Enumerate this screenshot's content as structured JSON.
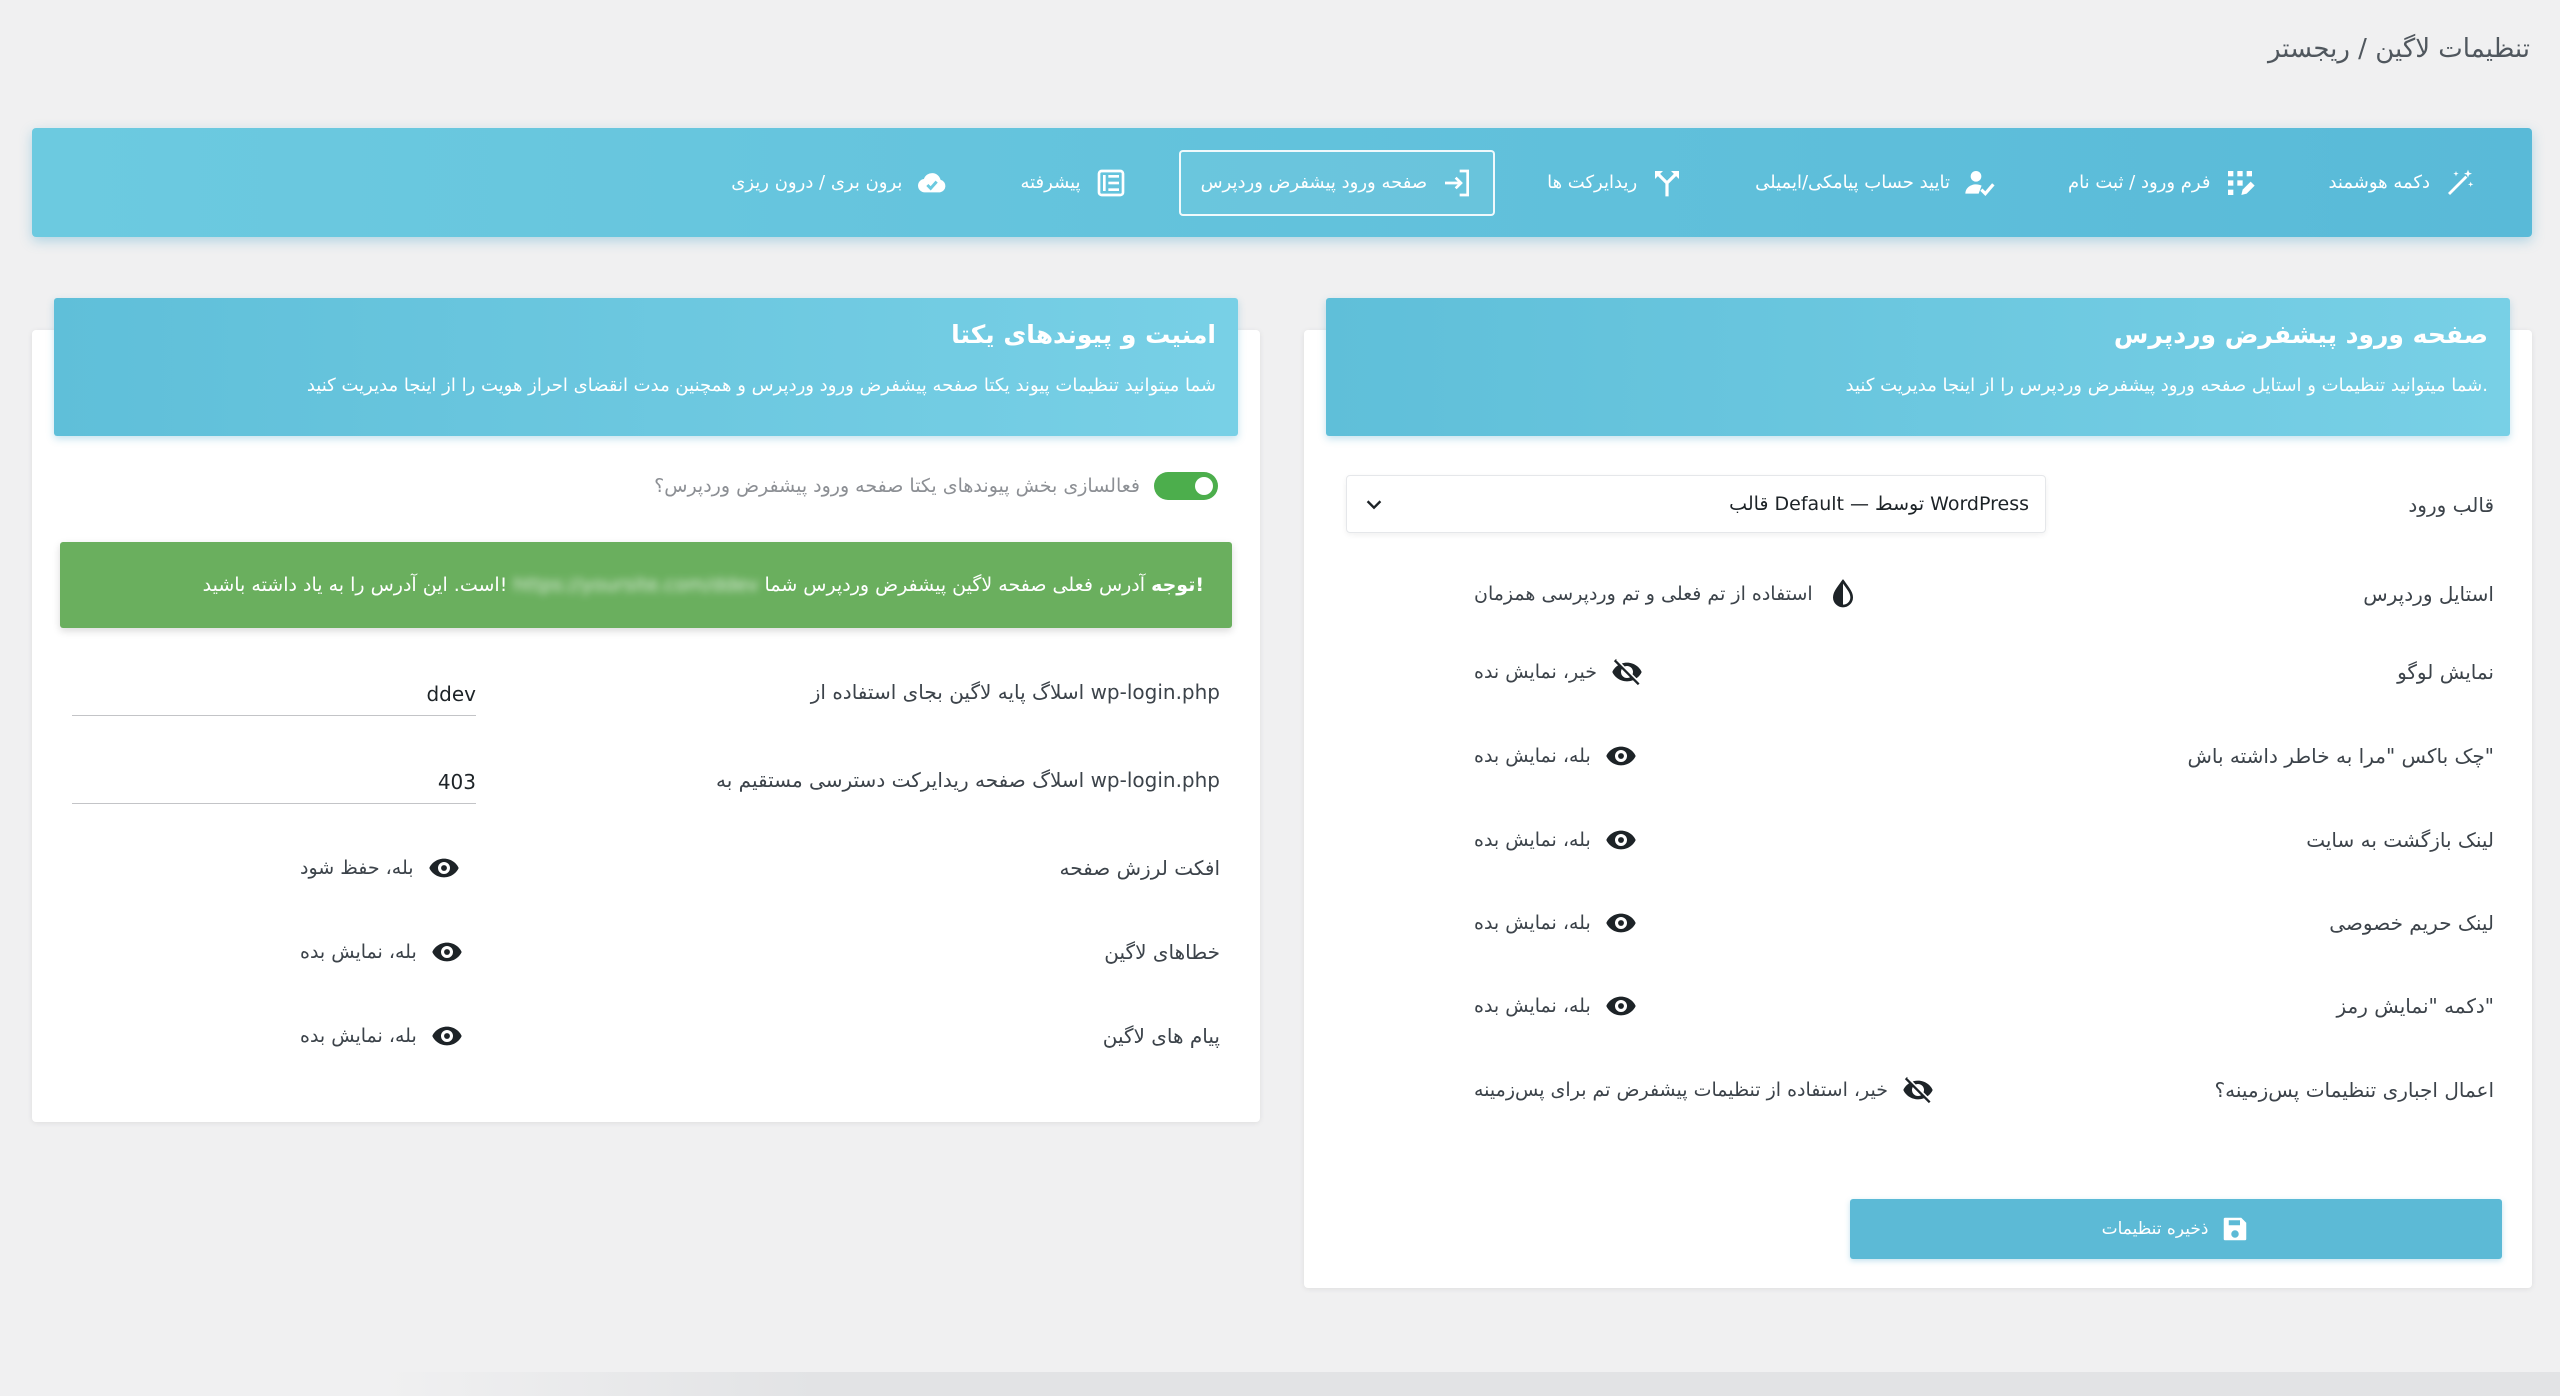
{
  "page": {
    "title": "تنظیمات لاگین / ریجستر"
  },
  "tabs": [
    {
      "label": "دکمه هوشمند",
      "icon": "magic-wand-icon"
    },
    {
      "label": "فرم ورود / ثبت نام",
      "icon": "grid-pencil-icon"
    },
    {
      "label": "تایید حساب پیامکی/ایمیلی",
      "icon": "user-check-icon"
    },
    {
      "label": "ریدایرکت ها",
      "icon": "split-arrows-icon"
    },
    {
      "label": "صفحه ورود پیشفرض وردپرس",
      "icon": "sign-in-icon",
      "active": true
    },
    {
      "label": "پیشرفته",
      "icon": "advanced-panel-icon"
    },
    {
      "label": "برون بری / درون ریزی",
      "icon": "cloud-check-icon"
    }
  ],
  "wp_login_card": {
    "title": "صفحه ورود پیشفرض وردپرس",
    "description": "شما میتوانید تنظیمات و استایل صفحه ورود پیشفرض وردپرس را از اینجا مدیریت کنید.",
    "template": {
      "label": "قالب ورود",
      "value": "قالب Default — توسط WordPress"
    },
    "rows": [
      {
        "label": "استایل وردپرس",
        "value": "استفاده از تم فعلی و تم وردپرسی همزمان",
        "icon": "half-drop-icon"
      },
      {
        "label": "نمایش لوگو",
        "value": "خیر، نمایش نده",
        "icon": "eye-slash-icon"
      },
      {
        "label": "چک باکس \"مرا به خاطر داشته باش\"",
        "value": "بله، نمایش بده",
        "icon": "eye-icon"
      },
      {
        "label": "لینک بازگشت به سایت",
        "value": "بله، نمایش بده",
        "icon": "eye-icon"
      },
      {
        "label": "لینک حریم خصوصی",
        "value": "بله، نمایش بده",
        "icon": "eye-icon"
      },
      {
        "label": "دکمه \"نمایش رمز\"",
        "value": "بله، نمایش بده",
        "icon": "eye-icon"
      },
      {
        "label": "اعمال اجباری تنظیمات پس‌زمینه؟",
        "value": "خیر، استفاده از تنظیمات پیشفرض تم برای پس‌زمینه",
        "icon": "eye-slash-icon"
      }
    ],
    "save_label": "ذخیره تنظیمات"
  },
  "security_card": {
    "title": "امنیت و پیوندهای یکتا",
    "description": "شما میتوانید تنظیمات پیوند یکتا صفحه پیشفرض ورود وردپرس و همچنین مدت انقضای احراز هویت را از اینجا مدیریت کنید",
    "toggle_label": "فعالسازی بخش پیوندهای یکتا صفحه ورود پیشفرض وردپرس؟",
    "toggle_on": true,
    "notice": {
      "strong": "توجه!",
      "before": "آدرس فعلی صفحه لاگین پیشفرض وردپرس شما",
      "url": "https://yoursite.com/ddev",
      "after": "است. این آدرس را به یاد داشته باشید!"
    },
    "slug_label": "اسلاگ پایه لاگین بجای استفاده از wp-login.php",
    "slug_value": "ddev",
    "redirect_label": "اسلاگ صفحه ریدایرکت دسترسی مستقیم به wp-login.php",
    "redirect_value": "403",
    "rows": [
      {
        "label": "افکت لرزش صفحه",
        "value": "بله، حفظ شود",
        "icon": "eye-icon"
      },
      {
        "label": "خطاهای لاگین",
        "value": "بله، نمایش بده",
        "icon": "eye-icon"
      },
      {
        "label": "پیام های لاگین",
        "value": "بله، نمایش بده",
        "icon": "eye-icon"
      }
    ]
  },
  "colors": {
    "accent": "#5cbad6",
    "success": "#6aaf5e",
    "toggle": "#4cae4c"
  }
}
